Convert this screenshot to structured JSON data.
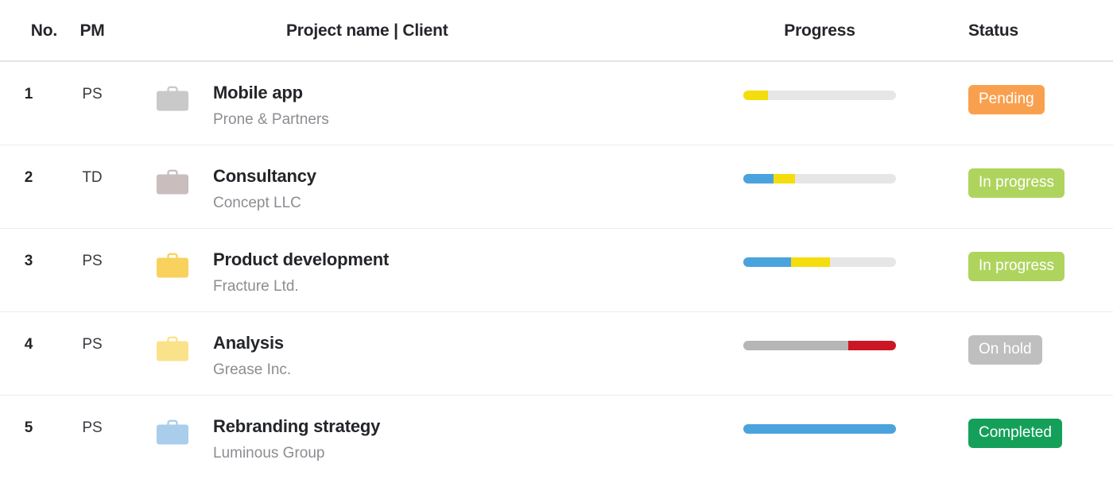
{
  "table": {
    "columns": {
      "no": "No.",
      "pm": "PM",
      "project": "Project name | Client",
      "progress": "Progress",
      "status": "Status"
    },
    "rows": [
      {
        "no": "1",
        "pm": "PS",
        "project_name": "Mobile app",
        "client": "Prone & Partners",
        "icon": "briefcase-icon",
        "icon_color": "#c9c9c9",
        "progress": {
          "segments": [
            {
              "color": "#f5dd0d",
              "percent": 16
            }
          ],
          "track_color": "#e6e6e6",
          "align": "left"
        },
        "status": {
          "label": "Pending",
          "color": "#f9a04e"
        }
      },
      {
        "no": "2",
        "pm": "TD",
        "project_name": "Consultancy",
        "client": "Concept LLC",
        "icon": "briefcase-icon",
        "icon_color": "#c9bdbd",
        "progress": {
          "segments": [
            {
              "color": "#4ba3dd",
              "percent": 20
            },
            {
              "color": "#f5dd0d",
              "percent": 14
            }
          ],
          "track_color": "#e6e6e6",
          "align": "left"
        },
        "status": {
          "label": "In progress",
          "color": "#aed45e"
        }
      },
      {
        "no": "3",
        "pm": "PS",
        "project_name": "Product development",
        "client": "Fracture Ltd.",
        "icon": "briefcase-icon",
        "icon_color": "#f8d25c",
        "progress": {
          "segments": [
            {
              "color": "#4ba3dd",
              "percent": 31
            },
            {
              "color": "#f5dd0d",
              "percent": 26
            }
          ],
          "track_color": "#e6e6e6",
          "align": "left"
        },
        "status": {
          "label": "In progress",
          "color": "#aed45e"
        }
      },
      {
        "no": "4",
        "pm": "PS",
        "project_name": "Analysis",
        "client": "Grease Inc.",
        "icon": "briefcase-icon",
        "icon_color": "#fae28a",
        "progress": {
          "segments": [
            {
              "color": "#b6b6b6",
              "percent": 69
            },
            {
              "color": "#cb1725",
              "percent": 31
            }
          ],
          "track_color": "#e6e6e6",
          "align": "left"
        },
        "status": {
          "label": "On hold",
          "color": "#bfbfbf"
        }
      },
      {
        "no": "5",
        "pm": "PS",
        "project_name": "Rebranding strategy",
        "client": "Luminous Group",
        "icon": "briefcase-icon",
        "icon_color": "#a9cdeb",
        "progress": {
          "segments": [
            {
              "color": "#4ba3dd",
              "percent": 100
            }
          ],
          "track_color": "#e6e6e6",
          "align": "left"
        },
        "status": {
          "label": "Completed",
          "color": "#15a05a"
        }
      }
    ]
  },
  "theme": {
    "header_border": "#e3e4e6",
    "row_border": "#ececec",
    "text_primary": "#232529",
    "text_muted": "#8b8d91",
    "background": "#ffffff"
  }
}
